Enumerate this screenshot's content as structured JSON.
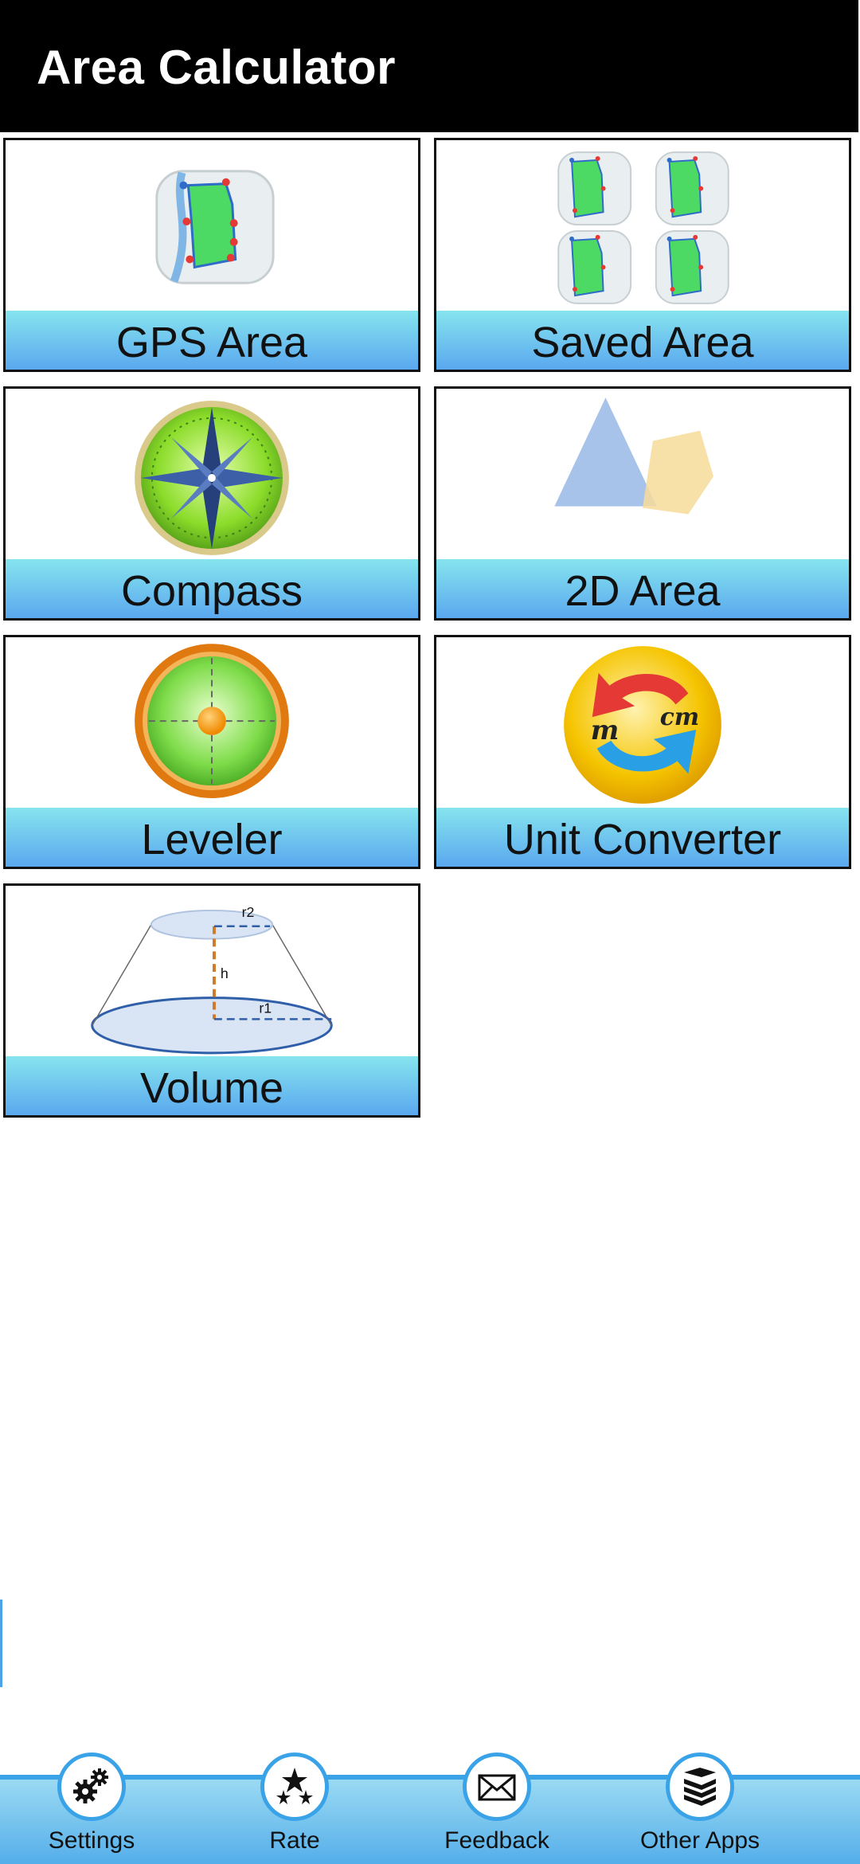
{
  "app": {
    "title": "Area Calculator"
  },
  "tiles": [
    {
      "label": "GPS Area",
      "icon": "gps-map-polygon-icon"
    },
    {
      "label": "Saved Area",
      "icon": "saved-maps-icon"
    },
    {
      "label": "Compass",
      "icon": "compass-icon"
    },
    {
      "label": "2D Area",
      "icon": "shapes-icon"
    },
    {
      "label": "Leveler",
      "icon": "level-bubble-icon"
    },
    {
      "label": "Unit Converter",
      "icon": "unit-convert-icon"
    },
    {
      "label": "Volume",
      "icon": "frustum-volume-icon"
    }
  ],
  "unit_converter_art": {
    "from": "m",
    "to": "cm"
  },
  "volume_art": {
    "r2": "r2",
    "h": "h",
    "r1": "r1"
  },
  "nav": [
    {
      "label": "Settings",
      "icon": "gears-icon"
    },
    {
      "label": "Rate",
      "icon": "stars-icon"
    },
    {
      "label": "Feedback",
      "icon": "envelope-icon"
    },
    {
      "label": "Other Apps",
      "icon": "books-icon"
    }
  ],
  "colors": {
    "accent": "#3aa3e8",
    "tile_label_top": "#86e4ee",
    "tile_label_bottom": "#5aa8ef"
  }
}
